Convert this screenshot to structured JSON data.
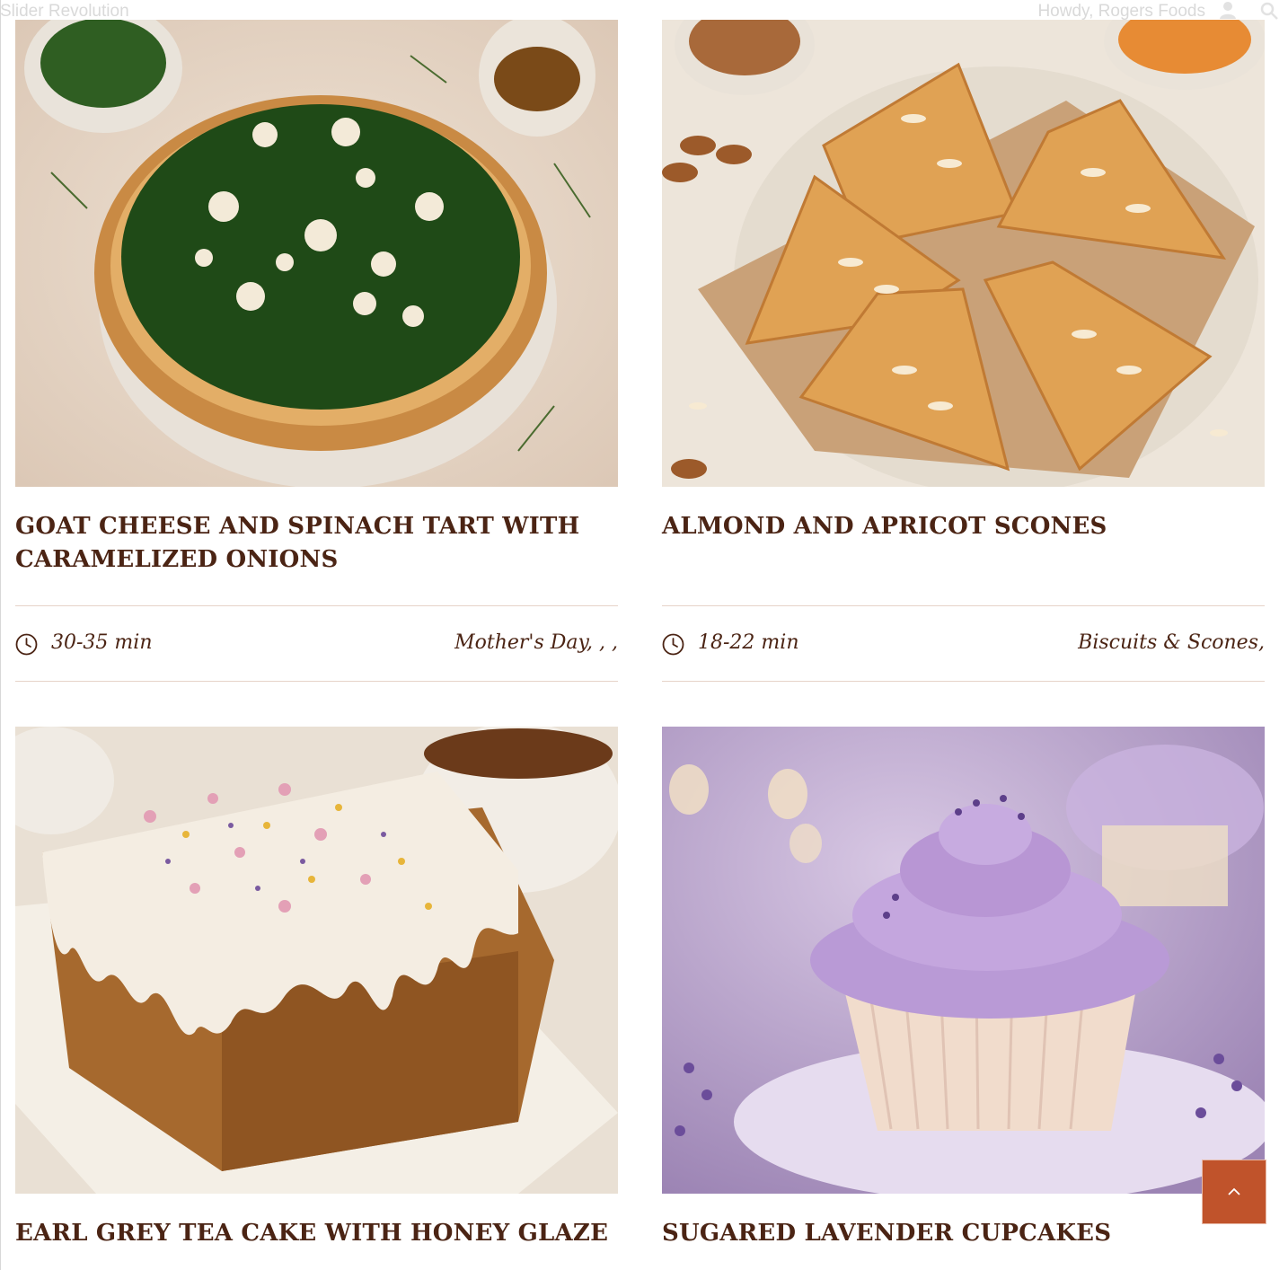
{
  "admin_bar": {
    "left_text": "Slider Revolution",
    "greeting": "Howdy, Rogers Foods"
  },
  "recipes": [
    {
      "title": "Goat Cheese and Spinach Tart with Caramelized Onions",
      "time": "30-35 min",
      "categories": "Mother's Day, , ,"
    },
    {
      "title": "Almond and Apricot Scones",
      "time": "18-22 min",
      "categories": "Biscuits & Scones,"
    },
    {
      "title": "Earl Grey Tea Cake with Honey Glaze"
    },
    {
      "title": "Sugared Lavender Cupcakes"
    }
  ],
  "icons": {
    "clock": "clock-icon",
    "back_to_top": "chevron-up-icon",
    "user": "user-icon",
    "search": "search-icon"
  },
  "colors": {
    "title": "#4b2414",
    "rule": "#e6d3c8",
    "back_to_top_bg": "#c0532b"
  }
}
